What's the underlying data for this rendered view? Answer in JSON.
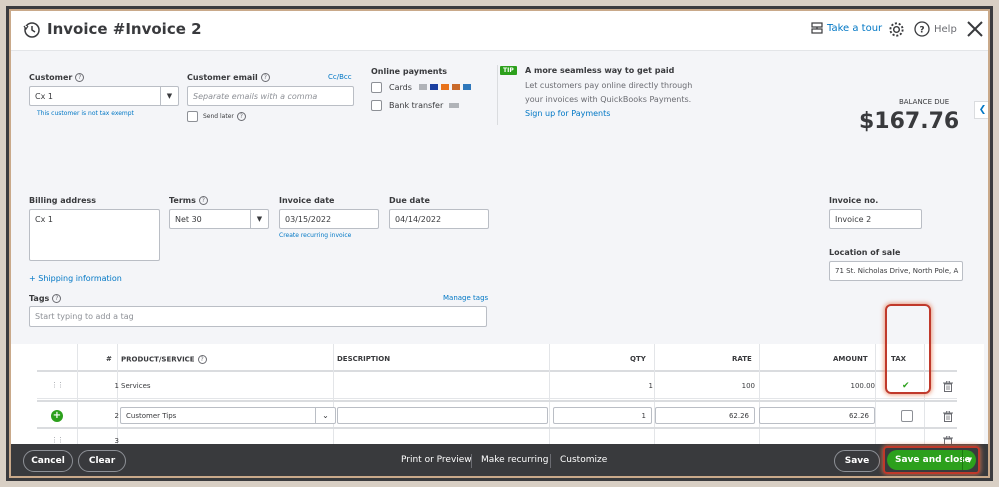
{
  "header": {
    "title": "Invoice #Invoice 2",
    "take_tour": "Take a tour",
    "help": "Help"
  },
  "customer": {
    "label": "Customer",
    "value": "Cx 1",
    "tax_note": "This customer is not tax exempt"
  },
  "customer_email": {
    "label": "Customer email",
    "placeholder": "Separate emails with a comma",
    "cc_bcc": "Cc/Bcc",
    "send_later": "Send later"
  },
  "online_payments": {
    "label": "Online payments",
    "cards": "Cards",
    "bank_transfer": "Bank transfer"
  },
  "tip": {
    "badge": "TIP",
    "title": "A more seamless way to get paid",
    "body_line1": "Let customers pay online directly through",
    "body_line2": "your invoices with QuickBooks Payments.",
    "signup": "Sign up for Payments"
  },
  "balance": {
    "label": "BALANCE DUE",
    "amount": "$167.76"
  },
  "billing": {
    "label": "Billing address",
    "value": "Cx 1"
  },
  "terms": {
    "label": "Terms",
    "value": "Net 30"
  },
  "invoice_date": {
    "label": "Invoice date",
    "value": "03/15/2022",
    "recurring_link": "Create recurring invoice"
  },
  "due_date": {
    "label": "Due date",
    "value": "04/14/2022"
  },
  "invoice_no": {
    "label": "Invoice no.",
    "value": "Invoice 2"
  },
  "location": {
    "label": "Location of sale",
    "value": "71 St. Nicholas Drive, North Pole, A"
  },
  "shipping_link": "+ Shipping information",
  "tags": {
    "label": "Tags",
    "manage": "Manage tags",
    "placeholder": "Start typing to add a tag"
  },
  "table": {
    "headers": {
      "num": "#",
      "product": "PRODUCT/SERVICE",
      "description": "DESCRIPTION",
      "qty": "QTY",
      "rate": "RATE",
      "amount": "AMOUNT",
      "tax": "TAX"
    },
    "rows": [
      {
        "num": "1",
        "product": "Services",
        "description": "",
        "qty": "1",
        "rate": "100",
        "amount": "100.00",
        "tax": "✔"
      },
      {
        "num": "2",
        "product": "Customer Tips",
        "description": "",
        "qty": "1",
        "rate": "62.26",
        "amount": "62.26",
        "tax": ""
      },
      {
        "num": "3",
        "product": "",
        "description": "",
        "qty": "",
        "rate": "",
        "amount": "",
        "tax": ""
      }
    ]
  },
  "footer": {
    "cancel": "Cancel",
    "clear": "Clear",
    "print_preview": "Print or Preview",
    "make_recurring": "Make recurring",
    "customize": "Customize",
    "save": "Save",
    "save_close": "Save and close"
  },
  "colors": {
    "accent_green": "#2ca01c",
    "link_blue": "#0077c5",
    "footer_dark": "#393a3d",
    "highlight_red": "#c0392b"
  }
}
